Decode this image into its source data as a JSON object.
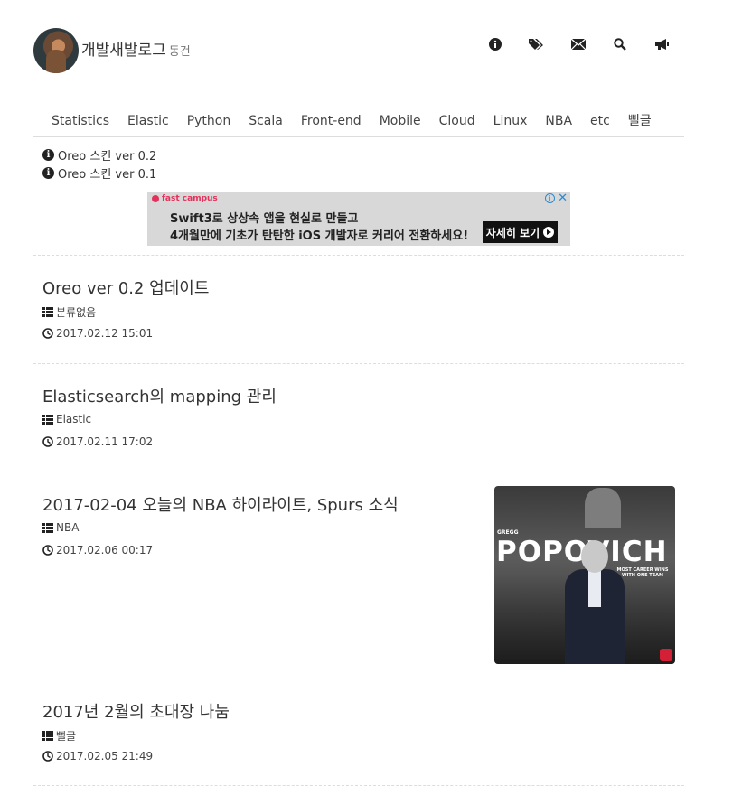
{
  "header": {
    "title": "개발새발로그",
    "subtitle": "동건",
    "icons": [
      "info-icon",
      "tags-icon",
      "envelope-icon",
      "search-icon",
      "bullhorn-icon"
    ]
  },
  "nav": {
    "items": [
      "Statistics",
      "Elastic",
      "Python",
      "Scala",
      "Front-end",
      "Mobile",
      "Cloud",
      "Linux",
      "NBA",
      "etc",
      "뻘글"
    ]
  },
  "notices": [
    {
      "label": "Oreo 스킨 ver 0.2"
    },
    {
      "label": "Oreo 스킨 ver 0.1"
    }
  ],
  "ad": {
    "brand": "fast campus",
    "line1": "Swift3로 상상속 앱을 현실로 만들고",
    "line2": "4개월만에 기초가 탄탄한 iOS 개발자로 커리어 전환하세요!",
    "cta": "자세히 보기",
    "info": "i",
    "close": "✕"
  },
  "posts": [
    {
      "title": "Oreo ver 0.2 업데이트",
      "category": "분류없음",
      "date": "2017.02.12 15:01"
    },
    {
      "title": "Elasticsearch의 mapping 관리",
      "category": "Elastic",
      "date": "2017.02.11 17:02"
    },
    {
      "title": "2017-02-04 오늘의 NBA 하이라이트, Spurs 소식",
      "category": "NBA",
      "date": "2017.02.06 00:17",
      "thumbnail": {
        "top": "GREGG",
        "name": "POPOVICH",
        "caption": "MOST CAREER WINS WITH ONE TEAM"
      }
    },
    {
      "title": "2017년 2월의 초대장 나눔",
      "category": "뻘글",
      "date": "2017.02.05 21:49"
    }
  ]
}
